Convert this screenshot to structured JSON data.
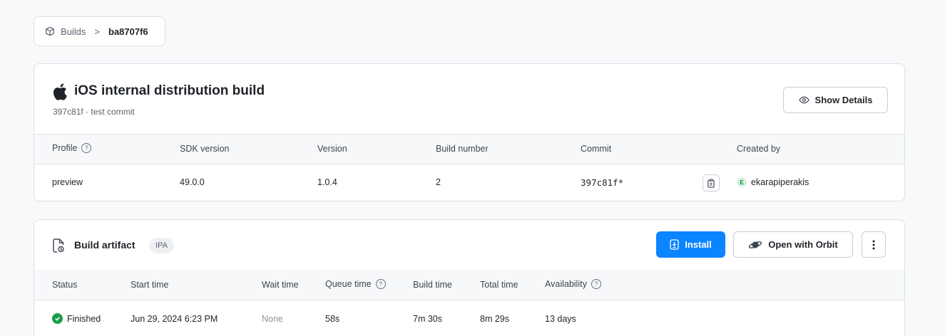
{
  "breadcrumb": {
    "root": "Builds",
    "separator": ">",
    "current": "ba8707f6"
  },
  "build": {
    "title": "iOS internal distribution build",
    "subtitle": "397c81f · test commit",
    "show_details_label": "Show Details",
    "columns": [
      "Profile",
      "SDK version",
      "Version",
      "Build number",
      "Commit",
      "Created by"
    ],
    "row": {
      "profile": "preview",
      "sdk_version": "49.0.0",
      "version": "1.0.4",
      "build_number": "2",
      "commit": "397c81f*",
      "creator_initial": "E",
      "created_by": "ekarapiperakis"
    }
  },
  "artifact": {
    "title": "Build artifact",
    "badge": "IPA",
    "install_label": "Install",
    "orbit_label": "Open with Orbit",
    "columns": [
      "Status",
      "Start time",
      "Wait time",
      "Queue time",
      "Build time",
      "Total time",
      "Availability"
    ],
    "row": {
      "status": "Finished",
      "start_time": "Jun 29, 2024 6:23 PM",
      "wait_time": "None",
      "queue_time": "58s",
      "build_time": "7m 30s",
      "total_time": "8m 29s",
      "availability": "13 days"
    }
  },
  "colors": {
    "accent": "#0a84ff",
    "success": "#1a9d4b",
    "avatar_bg": "#d4f3e0"
  }
}
